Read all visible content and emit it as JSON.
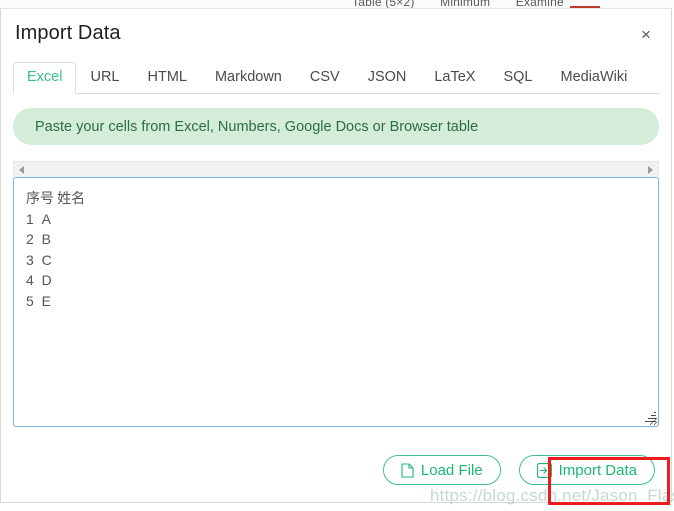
{
  "background": {
    "strip_items": [
      "Table (5×2)",
      "Minimum",
      "Examine"
    ]
  },
  "dialog": {
    "title": "Import Data",
    "close_label": "×",
    "tabs": [
      {
        "label": "Excel",
        "active": true
      },
      {
        "label": "URL",
        "active": false
      },
      {
        "label": "HTML",
        "active": false
      },
      {
        "label": "Markdown",
        "active": false
      },
      {
        "label": "CSV",
        "active": false
      },
      {
        "label": "JSON",
        "active": false
      },
      {
        "label": "LaTeX",
        "active": false
      },
      {
        "label": "SQL",
        "active": false
      },
      {
        "label": "MediaWiki",
        "active": false
      }
    ],
    "hint": "Paste your cells from Excel, Numbers, Google Docs or Browser table",
    "paste_area": {
      "value": "序号\t姓名\n1\tA\n2\tB\n3\tC\n4\tD\n5\tE\n",
      "placeholder": "",
      "rows": [
        [
          "序号",
          "姓名"
        ],
        [
          "1",
          "A"
        ],
        [
          "2",
          "B"
        ],
        [
          "3",
          "C"
        ],
        [
          "4",
          "D"
        ],
        [
          "5",
          "E"
        ]
      ]
    },
    "footer": {
      "load_file_label": "Load File",
      "import_data_label": "Import Data"
    }
  },
  "annotation": {
    "highlight_color": "#ee1c1c",
    "target": "Import Data"
  },
  "watermark": {
    "text": "https://blog.csdn.net/Jason_Flash"
  },
  "colors": {
    "accent_green": "#3dc08a",
    "hint_background": "#d3edd9",
    "hint_text": "#2f6b44",
    "focus_border": "#7fb6ef"
  }
}
